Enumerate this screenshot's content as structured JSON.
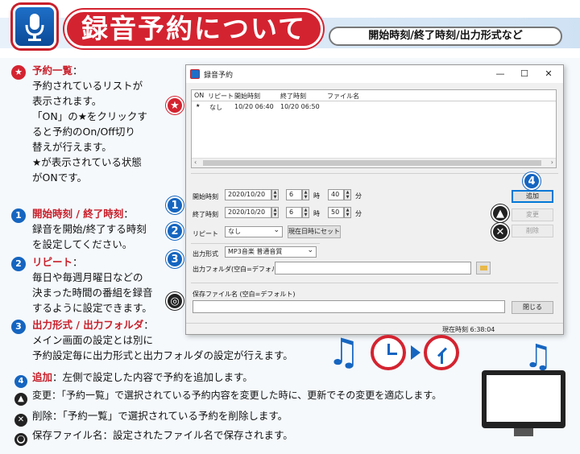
{
  "header": {
    "title": "録音予約について",
    "subtitle": "開始時刻/終了時刻/出力形式など"
  },
  "left": {
    "reserve_list_head": "予約一覧",
    "reserve_list_lines": [
      "予約されているリストが",
      "表示されます。",
      "「ON」の★をクリックす",
      "ると予約のOn/Off切り",
      "替えが行えます。",
      "★が表示されている状態",
      "がONです。"
    ],
    "time_head": "開始時刻 / 終了時刻",
    "time_lines": [
      "録音を開始/終了する時刻",
      "を設定してください。"
    ],
    "repeat_head": "リピート",
    "repeat_lines": [
      "毎日や毎週月曜日などの",
      "決まった時間の番組を録音",
      "するように設定できます。"
    ],
    "format_head": "出力形式 / 出力フォルダ",
    "format_lines": [
      "メイン画面の設定とは別に",
      "予約設定毎に出力形式と出力フォルダの設定が行えます。"
    ]
  },
  "bottom": {
    "add_head": "追加",
    "add_text": "：左側で設定した内容で予約を追加します。",
    "change_head": "変更",
    "change_text": "：「予約一覧」で選択されている予約内容を変更した時に、更新でその変更を適応します。",
    "delete_head": "削除",
    "delete_text": "：「予約一覧」で選択されている予約を削除します。",
    "save_head": "保存ファイル名",
    "save_text": "：設定されたファイル名で保存されます。"
  },
  "window": {
    "title": "録音予約",
    "controls": [
      "—",
      "☐",
      "✕"
    ],
    "columns": [
      "ON",
      "リピート",
      "開始時刻",
      "終了時刻",
      "ファイル名"
    ],
    "rows": [
      {
        "on": "★",
        "repeat": "なし",
        "start": "10/20 06:40",
        "end": "10/20 06:50",
        "file": ""
      }
    ],
    "start_label": "開始時刻",
    "end_label": "終了時刻",
    "start_date": "2020/10/20",
    "end_date": "2020/10/20",
    "start_hour": "6",
    "start_min": "40",
    "end_hour": "6",
    "end_min": "50",
    "hour_unit": "時",
    "min_unit": "分",
    "repeat_label": "リピート",
    "repeat_value": "なし",
    "set_now_button": "現在日時にセット",
    "format_label": "出力形式",
    "format_value": "MP3音楽 普通音質",
    "folder_label": "出力フォルダ(空白=デフォルト)",
    "folder_value": "",
    "save_name_label": "保存ファイル名 (空白=デフォルト)",
    "save_name_value": "",
    "add_button": "追加",
    "change_button": "変更",
    "delete_button": "削除",
    "close_button": "閉じる",
    "status": "現在時刻 6:38:04"
  },
  "callouts": {
    "star": "★",
    "one": "1",
    "two": "2",
    "three": "3",
    "four": "4"
  },
  "icons": [
    "microphone-icon",
    "music-note-icon",
    "clock-icon",
    "monitor-icon"
  ],
  "colors": {
    "brand_red": "#d42330",
    "brand_blue": "#1565c0"
  }
}
